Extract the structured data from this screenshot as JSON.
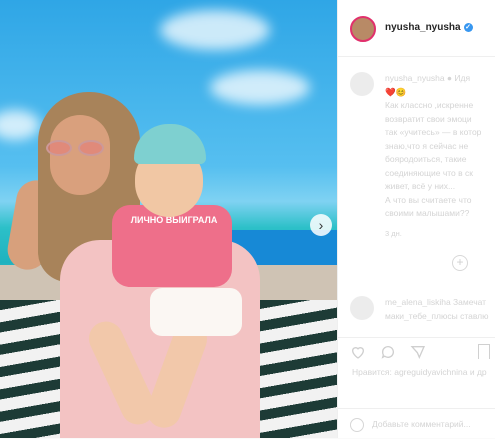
{
  "post": {
    "username": "nyusha_nyusha",
    "verified_glyph": "✓",
    "photo_alt": "mother and child by the sea",
    "kid_shirt_text": "ЛИЧНО ВЫИГРАЛА",
    "next_icon": "›",
    "carousel": {
      "count": 2,
      "active": 0
    }
  },
  "caption": {
    "lines": [
      "nyusha_nyusha ● Идя",
      "❤️😊",
      "Как классно ,искренне",
      "возвратит свои эмоци",
      "так «учитесь» — в котор",
      "знаю,что я сейчас не",
      "бояродоиться, такие",
      "соединяющие что в ск",
      "живет, всё у них...",
      "А что вы считаете что",
      "своими малышами??"
    ],
    "time": "3 дн."
  },
  "comment": {
    "lines": [
      "me_alena_liskiha Замечат",
      "маки_тебе_плюсы ставлю"
    ]
  },
  "likes": {
    "text": "Нравится: agreguidyavichnina и др"
  },
  "actions": {
    "like_icon": "heart-icon",
    "comment_icon": "comment-icon",
    "share_icon": "share-icon",
    "bookmark_icon": "bookmark-icon",
    "plus_glyph": "+"
  },
  "comment_box": {
    "placeholder": "Добавьте комментарий..."
  }
}
